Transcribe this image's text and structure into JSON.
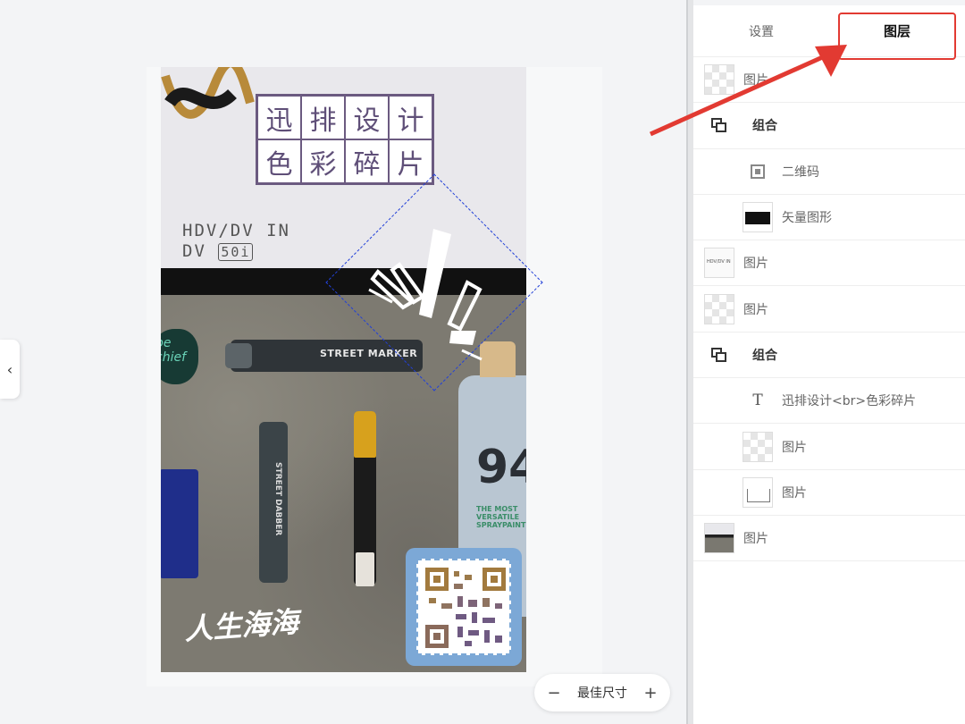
{
  "canvas": {
    "poster": {
      "title_chars": [
        "迅",
        "排",
        "设",
        "计",
        "色",
        "彩",
        "碎",
        "片"
      ],
      "hand_text_line1": "HDV/DV IN",
      "hand_text_line2_prefix": "DV",
      "hand_text_line2_boxed": "50i",
      "signature": "人生海海",
      "marker_label_horizontal": "STREET MARKER",
      "marker_label_vertical": "STREET DABBER",
      "can_number": "94",
      "can_text": "THE MOST VERSATILE SPRAYPAINT",
      "sticker_text": "be chief"
    },
    "zoom": {
      "minus": "−",
      "label": "最佳尺寸",
      "plus": "+"
    },
    "collapse_icon": "chevron-left-icon"
  },
  "panel": {
    "tabs": [
      {
        "label": "设置",
        "active": false
      },
      {
        "label": "图层",
        "active": true
      }
    ],
    "layers": [
      {
        "name": "图片",
        "kind": "image",
        "level": 0,
        "thumb": "checker"
      },
      {
        "name": "组合",
        "kind": "group",
        "level": 0
      },
      {
        "name": "二维码",
        "kind": "qrcode",
        "level": 1
      },
      {
        "name": "矢量图形",
        "kind": "vector",
        "level": 1,
        "thumb": "vector"
      },
      {
        "name": "图片",
        "kind": "image",
        "level": 0,
        "thumb": "text-img"
      },
      {
        "name": "图片",
        "kind": "image",
        "level": 0,
        "thumb": "checker"
      },
      {
        "name": "组合",
        "kind": "group",
        "level": 0
      },
      {
        "name": "迅排设计<br>色彩碎片",
        "kind": "text",
        "level": 1
      },
      {
        "name": "图片",
        "kind": "image",
        "level": 1,
        "thumb": "checker"
      },
      {
        "name": "图片",
        "kind": "image",
        "level": 1,
        "thumb": "frame-img"
      },
      {
        "name": "图片",
        "kind": "image",
        "level": 0,
        "thumb": "photo"
      }
    ]
  },
  "colors": {
    "highlight": "#e23a32",
    "selection": "#2240d8",
    "title_purple": "#5f4f78",
    "qr_stamp": "#7ca8d6"
  }
}
